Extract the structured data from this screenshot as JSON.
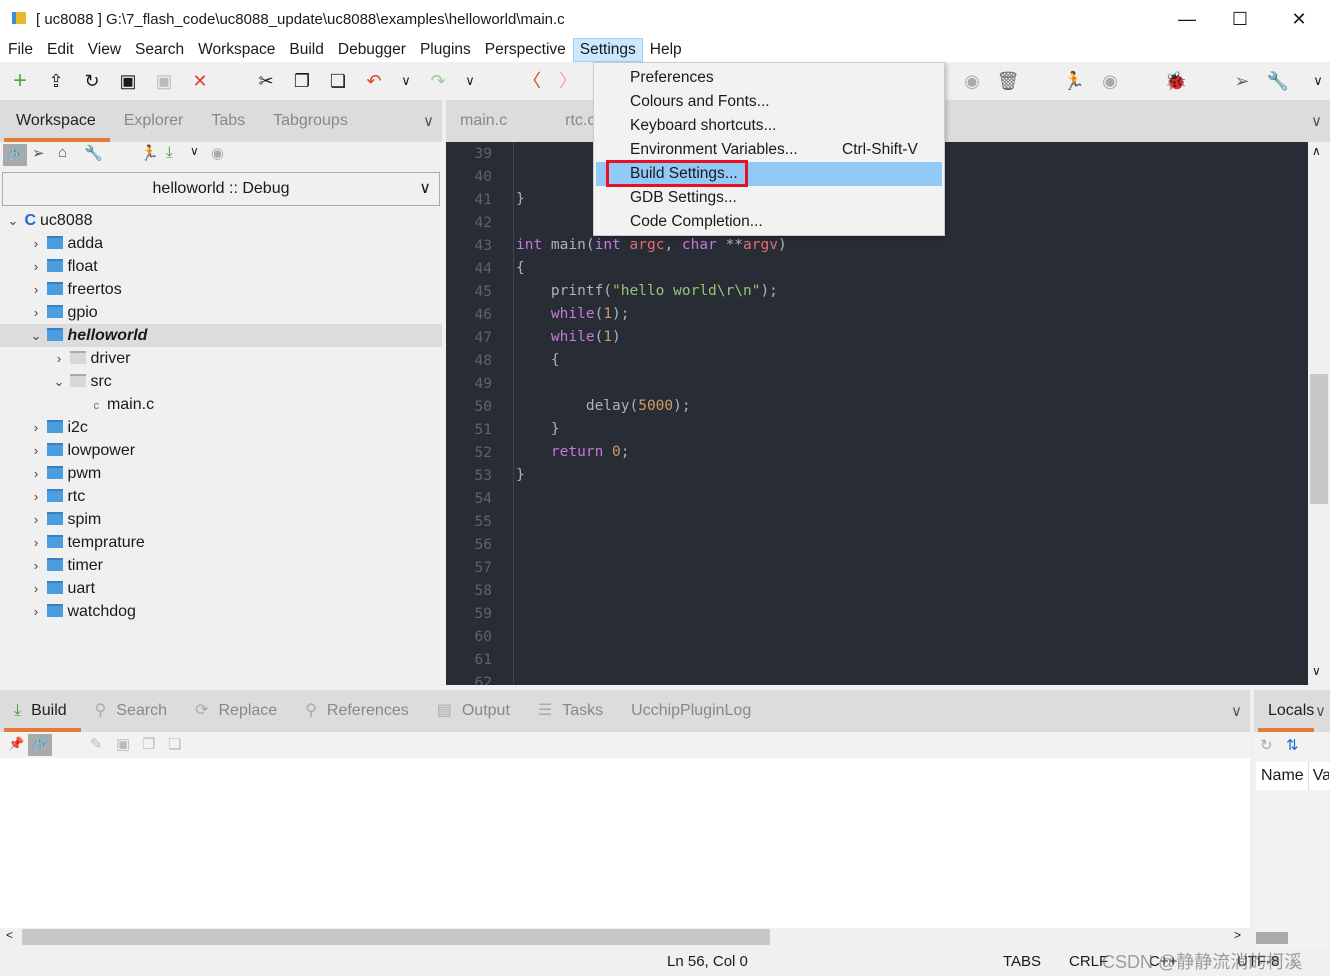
{
  "window": {
    "title": "[ uc8088 ] G:\\7_flash_code\\uc8088_update\\uc8088\\examples\\helloworld\\main.c",
    "minimize": "—",
    "maximize": "☐",
    "close": "✕"
  },
  "menubar": [
    "File",
    "Edit",
    "View",
    "Search",
    "Workspace",
    "Build",
    "Debugger",
    "Plugins",
    "Perspective",
    "Settings",
    "Help"
  ],
  "settings_menu": {
    "items": [
      {
        "label": "Preferences"
      },
      {
        "label": "Colours and Fonts..."
      },
      {
        "label": "Keyboard shortcuts..."
      },
      {
        "label": "Environment Variables...",
        "shortcut": "Ctrl-Shift-V"
      },
      {
        "label": "Build Settings...",
        "highlighted": true
      },
      {
        "label": "GDB Settings..."
      },
      {
        "label": "Code Completion..."
      }
    ]
  },
  "left_panel": {
    "tabs": [
      "Workspace",
      "Explorer",
      "Tabs",
      "Tabgroups"
    ],
    "config": "helloworld :: Debug",
    "tree": [
      {
        "label": "uc8088",
        "depth": 0,
        "open": true,
        "type": "workspace"
      },
      {
        "label": "adda",
        "depth": 1
      },
      {
        "label": "float",
        "depth": 1
      },
      {
        "label": "freertos",
        "depth": 1
      },
      {
        "label": "gpio",
        "depth": 1
      },
      {
        "label": "helloworld",
        "depth": 1,
        "open": true,
        "active": true
      },
      {
        "label": "driver",
        "depth": 2,
        "type": "vfolder"
      },
      {
        "label": "src",
        "depth": 2,
        "open": true,
        "type": "vfolder"
      },
      {
        "label": "main.c",
        "depth": 3,
        "type": "file"
      },
      {
        "label": "i2c",
        "depth": 1
      },
      {
        "label": "lowpower",
        "depth": 1
      },
      {
        "label": "pwm",
        "depth": 1
      },
      {
        "label": "rtc",
        "depth": 1
      },
      {
        "label": "spim",
        "depth": 1
      },
      {
        "label": "temprature",
        "depth": 1
      },
      {
        "label": "timer",
        "depth": 1
      },
      {
        "label": "uart",
        "depth": 1
      },
      {
        "label": "watchdog",
        "depth": 1
      }
    ]
  },
  "editor": {
    "tabs": [
      "main.c",
      "rtc.c"
    ],
    "first_line": 39,
    "last_line": 62
  },
  "bottom_panel": {
    "tabs": [
      "Build",
      "Search",
      "Replace",
      "References",
      "Output",
      "Tasks",
      "UcchipPluginLog"
    ],
    "right_tab": "Locals",
    "columns": [
      "Name",
      "Value"
    ]
  },
  "statusbar": {
    "position": "Ln 56, Col 0",
    "indent": "TABS",
    "eol": "CRLF",
    "lang": "C++",
    "encoding": "UTF-8",
    "watermark": "CSDN @静静流淌的柯溪"
  },
  "colors": {
    "accent": "#e07b39",
    "editor_bg": "#282c34",
    "menu_highlight": "#91c9f7",
    "annotation": "#e81123"
  }
}
